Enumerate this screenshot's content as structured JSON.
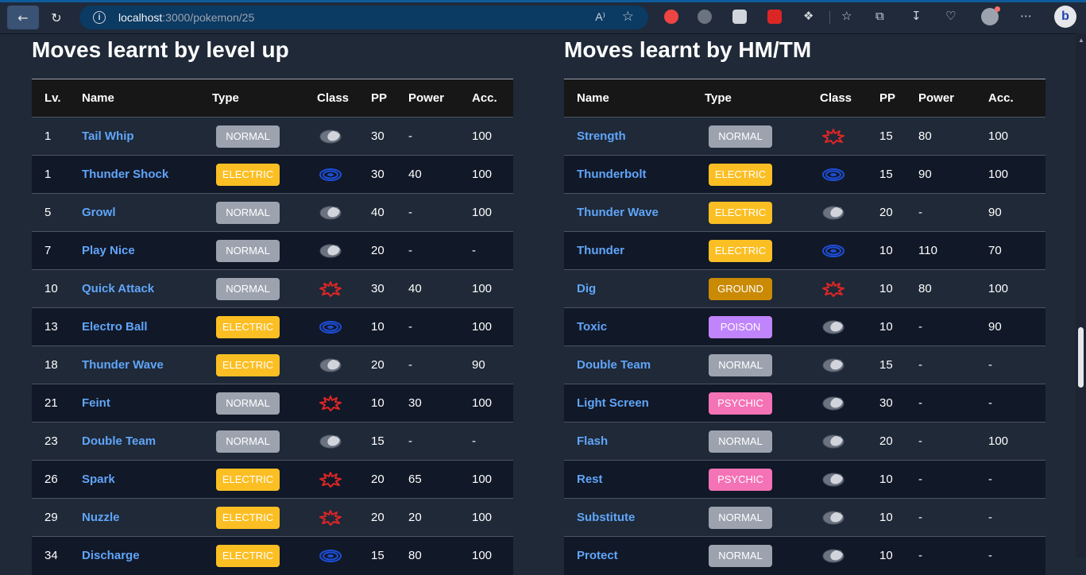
{
  "browser": {
    "url_host": "localhost",
    "url_path": ":3000/pokemon/25"
  },
  "type_colors": {
    "NORMAL": "#9ca3af",
    "ELECTRIC": "#fbbf24",
    "GROUND": "#ca8a04",
    "POISON": "#c084fc",
    "PSYCHIC": "#f472b6"
  },
  "level_up": {
    "title": "Moves learnt by level up",
    "headers": {
      "lv": "Lv.",
      "name": "Name",
      "type": "Type",
      "class": "Class",
      "pp": "PP",
      "power": "Power",
      "acc": "Acc."
    },
    "rows": [
      {
        "lv": "1",
        "name": "Tail Whip",
        "type": "NORMAL",
        "class": "status",
        "pp": "30",
        "power": "-",
        "acc": "100"
      },
      {
        "lv": "1",
        "name": "Thunder Shock",
        "type": "ELECTRIC",
        "class": "special",
        "pp": "30",
        "power": "40",
        "acc": "100"
      },
      {
        "lv": "5",
        "name": "Growl",
        "type": "NORMAL",
        "class": "status",
        "pp": "40",
        "power": "-",
        "acc": "100"
      },
      {
        "lv": "7",
        "name": "Play Nice",
        "type": "NORMAL",
        "class": "status",
        "pp": "20",
        "power": "-",
        "acc": "-"
      },
      {
        "lv": "10",
        "name": "Quick Attack",
        "type": "NORMAL",
        "class": "physical",
        "pp": "30",
        "power": "40",
        "acc": "100"
      },
      {
        "lv": "13",
        "name": "Electro Ball",
        "type": "ELECTRIC",
        "class": "special",
        "pp": "10",
        "power": "-",
        "acc": "100"
      },
      {
        "lv": "18",
        "name": "Thunder Wave",
        "type": "ELECTRIC",
        "class": "status",
        "pp": "20",
        "power": "-",
        "acc": "90"
      },
      {
        "lv": "21",
        "name": "Feint",
        "type": "NORMAL",
        "class": "physical",
        "pp": "10",
        "power": "30",
        "acc": "100"
      },
      {
        "lv": "23",
        "name": "Double Team",
        "type": "NORMAL",
        "class": "status",
        "pp": "15",
        "power": "-",
        "acc": "-"
      },
      {
        "lv": "26",
        "name": "Spark",
        "type": "ELECTRIC",
        "class": "physical",
        "pp": "20",
        "power": "65",
        "acc": "100"
      },
      {
        "lv": "29",
        "name": "Nuzzle",
        "type": "ELECTRIC",
        "class": "physical",
        "pp": "20",
        "power": "20",
        "acc": "100"
      },
      {
        "lv": "34",
        "name": "Discharge",
        "type": "ELECTRIC",
        "class": "special",
        "pp": "15",
        "power": "80",
        "acc": "100"
      }
    ]
  },
  "hm_tm": {
    "title": "Moves learnt by HM/TM",
    "headers": {
      "name": "Name",
      "type": "Type",
      "class": "Class",
      "pp": "PP",
      "power": "Power",
      "acc": "Acc."
    },
    "rows": [
      {
        "name": "Strength",
        "type": "NORMAL",
        "class": "physical",
        "pp": "15",
        "power": "80",
        "acc": "100"
      },
      {
        "name": "Thunderbolt",
        "type": "ELECTRIC",
        "class": "special",
        "pp": "15",
        "power": "90",
        "acc": "100"
      },
      {
        "name": "Thunder Wave",
        "type": "ELECTRIC",
        "class": "status",
        "pp": "20",
        "power": "-",
        "acc": "90"
      },
      {
        "name": "Thunder",
        "type": "ELECTRIC",
        "class": "special",
        "pp": "10",
        "power": "110",
        "acc": "70"
      },
      {
        "name": "Dig",
        "type": "GROUND",
        "class": "physical",
        "pp": "10",
        "power": "80",
        "acc": "100"
      },
      {
        "name": "Toxic",
        "type": "POISON",
        "class": "status",
        "pp": "10",
        "power": "-",
        "acc": "90"
      },
      {
        "name": "Double Team",
        "type": "NORMAL",
        "class": "status",
        "pp": "15",
        "power": "-",
        "acc": "-"
      },
      {
        "name": "Light Screen",
        "type": "PSYCHIC",
        "class": "status",
        "pp": "30",
        "power": "-",
        "acc": "-"
      },
      {
        "name": "Flash",
        "type": "NORMAL",
        "class": "status",
        "pp": "20",
        "power": "-",
        "acc": "100"
      },
      {
        "name": "Rest",
        "type": "PSYCHIC",
        "class": "status",
        "pp": "10",
        "power": "-",
        "acc": "-"
      },
      {
        "name": "Substitute",
        "type": "NORMAL",
        "class": "status",
        "pp": "10",
        "power": "-",
        "acc": "-"
      },
      {
        "name": "Protect",
        "type": "NORMAL",
        "class": "status",
        "pp": "10",
        "power": "-",
        "acc": "-"
      }
    ]
  }
}
